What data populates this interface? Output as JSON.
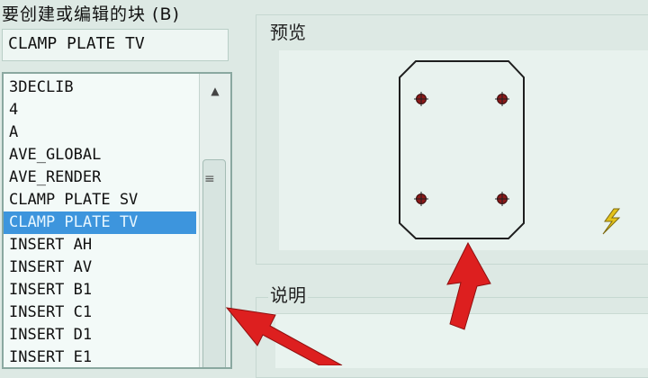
{
  "dialog": {
    "prompt_label": "要创建或编辑的块 (B)",
    "block_name_value": "CLAMP PLATE TV",
    "preview_label": "预览",
    "description_label": "说明"
  },
  "block_list": {
    "items": [
      {
        "label": "3DECLIB"
      },
      {
        "label": "4"
      },
      {
        "label": "A"
      },
      {
        "label": "AVE_GLOBAL"
      },
      {
        "label": "AVE_RENDER"
      },
      {
        "label": "CLAMP PLATE SV"
      },
      {
        "label": "CLAMP PLATE TV",
        "selected": true
      },
      {
        "label": "INSERT AH"
      },
      {
        "label": "INSERT AV"
      },
      {
        "label": "INSERT B1"
      },
      {
        "label": "INSERT C1"
      },
      {
        "label": "INSERT D1"
      },
      {
        "label": "INSERT E1"
      }
    ],
    "selected_index": 6
  },
  "icons": {
    "scroll_up": "chevron-up-icon",
    "scroll_grip": "grip-icon",
    "lightning": "lightning-icon",
    "annotation_arrows": "red-arrow-icon"
  },
  "colors": {
    "selection": "#3d95dd",
    "arrow": "#dd1f1f",
    "lightning": "#e3c21a",
    "hole": "#8b1a1a"
  }
}
